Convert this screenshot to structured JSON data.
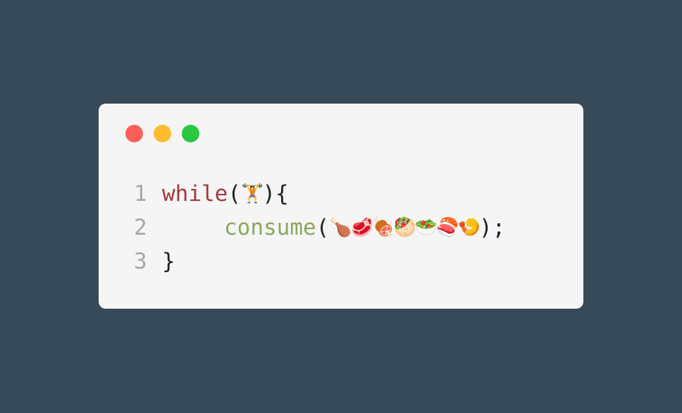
{
  "window": {
    "traffic_lights": {
      "close_color": "#fe5f58",
      "minimize_color": "#febc2e",
      "maximize_color": "#28c841"
    }
  },
  "code": {
    "lines": [
      {
        "number": "1",
        "keyword": "while",
        "open_paren": "(",
        "argument": "🏋️",
        "close": "){"
      },
      {
        "number": "2",
        "function": "consume",
        "open_paren": "(",
        "arguments": "🍗🥩🍖🥙🥗🍣🍤",
        "close": ");"
      },
      {
        "number": "3",
        "text": "}"
      }
    ]
  },
  "colors": {
    "background": "#364a59",
    "card": "#f5f5f5",
    "keyword": "#a2393f",
    "function": "#8aa95a",
    "line_number": "#a7a7a7",
    "text": "#222222"
  }
}
